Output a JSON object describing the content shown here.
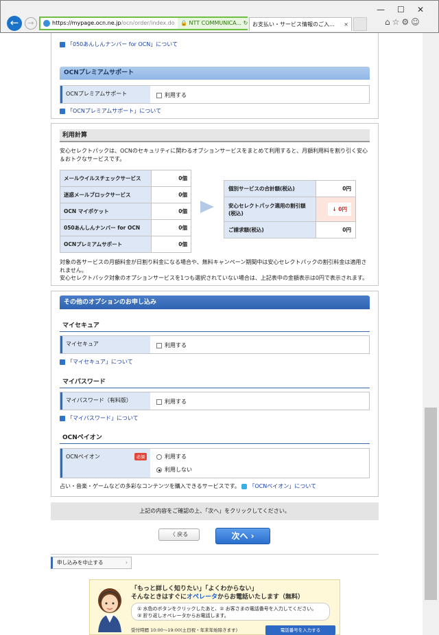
{
  "browser": {
    "url_host": "https://mypage.ocn.ne.jp",
    "url_path": "/ocn/order/index.do",
    "addr_controls": "⚲ ▾",
    "security": "🔒 NTT COMMUNICA... ↻",
    "tab_title": "お支払い・サービス情報のご入...",
    "tab_close": "×",
    "window_controls": [
      "—",
      "☐",
      "✕"
    ],
    "toolbar_icons": "⌂☆⚙☺"
  },
  "section_050_link": "「050あんしんナンバー for OCN」について",
  "premium": {
    "header": "OCNプレミアムサポート",
    "label": "OCNプレミアムサポート",
    "option": "利用する",
    "link": "「OCNプレミアムサポート」について"
  },
  "calc": {
    "header": "利用計算",
    "desc": "安心セレクトパックは、OCNのセキュリティに関わるオプションサービスをまとめて利用すると、月額利用料を割り引く安心＆おトクなサービスです。",
    "items": [
      {
        "name": "メールウイルスチェックサービス",
        "count": "0個"
      },
      {
        "name": "迷惑メールブロックサービス",
        "count": "0個"
      },
      {
        "name": "OCN マイポケット",
        "count": "0個"
      },
      {
        "name": "050あんしんナンバー for OCN",
        "count": "0個"
      },
      {
        "name": "OCNプレミアムサポート",
        "count": "0個"
      }
    ],
    "individual_label": "個別サービスの合計額(税込)",
    "individual_value": "0円",
    "discount_label": "安心セレクトパック適用の割引額(税込)",
    "discount_value": "0円",
    "discount_arrow": "↓",
    "total_label": "ご請求額(税込)",
    "total_value": "0円",
    "note1": "対象の各サービスの月額料金が日割り料金になる場合や、無料キャンペーン期間中は安心セレクトパックの割引料金は適用されません。",
    "note2": "安心セレクトパック対象のオプションサービスを1つも選択されていない場合は、上記表中の金額表示は0円で表示されます。"
  },
  "other": {
    "header": "その他のオプションのお申し込み",
    "mysecure": {
      "title": "マイセキュア",
      "label": "マイセキュア",
      "option": "利用する",
      "link": "「マイセキュア」について"
    },
    "mypassword": {
      "title": "マイパスワード",
      "label": "マイパスワード（有料版）",
      "option": "利用する",
      "link": "「マイパスワード」について"
    },
    "payon": {
      "title": "OCNペイオン",
      "label": "OCNペイオン",
      "required": "必須",
      "option1": "利用する",
      "option2": "利用しない",
      "note": "占い・音楽・ゲームなどの多彩なコンテンツを購入できるサービスです。",
      "link": "「OCNペイオン」について"
    }
  },
  "confirm_text": "上記の内容をご確認の上、「次へ」をクリックしてください。",
  "back_button": "〈 戻る",
  "next_button": "次へ ›",
  "cancel_button": "申し込みを中止する",
  "cancel_chevron": "›",
  "banner": {
    "line1": "「もっと詳しく知りたい」「よくわからない」",
    "line2a": "そんなときはすぐに",
    "line2b": "オペレータ",
    "line2c": "からお電話いたします（無料）",
    "step1": "① 水色のボタンをクリックしたあと、② お客さまの電話番号を入力してください。",
    "step2": "③ 折り返しオペレータからお電話します。",
    "hours": "受付時間 10:00〜19:00(土日祝・年末年始除きます)",
    "tel_button": "電話番号を入力する"
  }
}
